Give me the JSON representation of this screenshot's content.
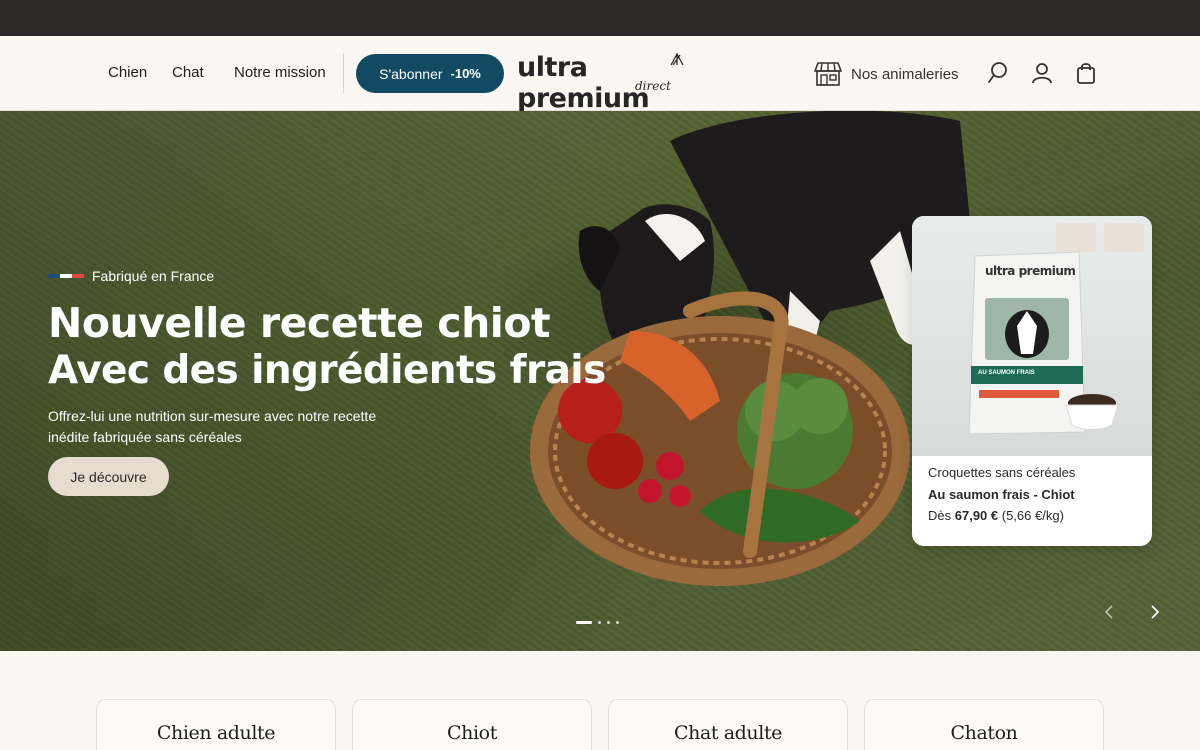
{
  "header": {
    "nav": [
      "Chien",
      "Chat",
      "Notre mission"
    ],
    "subscribe_label": "S'abonner",
    "subscribe_discount": "-10%",
    "logo_main": "ultra premium",
    "logo_sub": "direct",
    "stores_label": "Nos animaleries",
    "icons": [
      "store-icon",
      "search-icon",
      "account-icon",
      "cart-icon"
    ]
  },
  "hero": {
    "origin": "Fabriqué en France",
    "title": "Nouvelle recette chiot",
    "subtitle": "Avec des ingrédients frais",
    "description": "Offrez-lui une nutrition sur-mesure avec notre recette inédite fabriquée sans céréales",
    "cta": "Je découvre",
    "slides_count": 4,
    "active_slide": 1
  },
  "product": {
    "category": "Croquettes sans céréales",
    "name": "Au saumon frais - Chiot",
    "price_prefix": "Dès",
    "price": "67,90 €",
    "unit_price": "(5,66 €/kg)",
    "bag_brand": "ultra premium",
    "bag_label": "AU SAUMON FRAIS"
  },
  "categories": [
    "Chien adulte",
    "Chiot",
    "Chat adulte",
    "Chaton"
  ],
  "colors": {
    "topbar": "#2b2a29",
    "primary": "#134a63",
    "cream": "#fbf8f4",
    "cta": "#e7dcd0"
  }
}
